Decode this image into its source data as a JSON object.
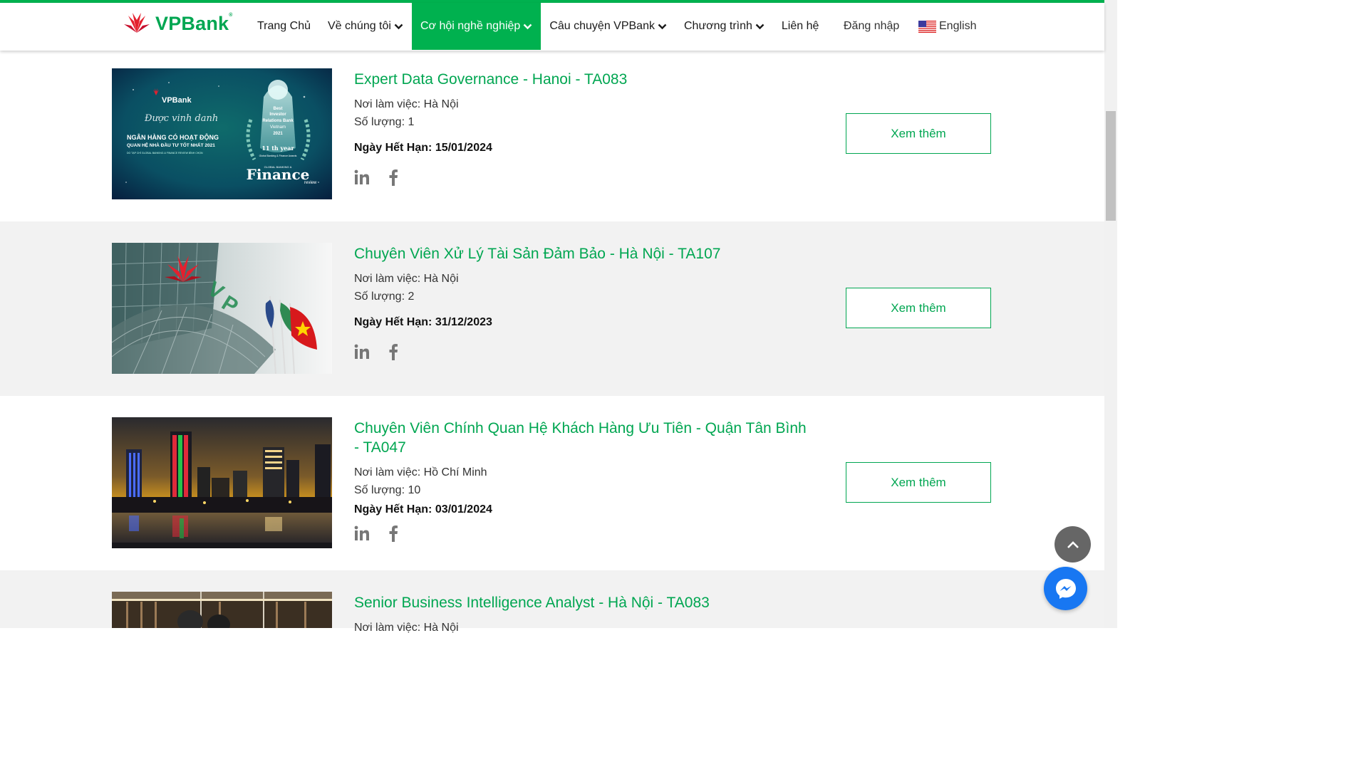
{
  "brand": {
    "name": "VPBank",
    "mark": "®",
    "color": "#00a651",
    "accent": "#00b14f",
    "red": "#e4202e"
  },
  "nav": {
    "items": [
      {
        "label": "Trang Chủ",
        "dropdown": false,
        "active": false
      },
      {
        "label": "Về chúng tôi",
        "dropdown": true,
        "active": false
      },
      {
        "label": "Cơ hội nghề nghiệp",
        "dropdown": true,
        "active": true
      },
      {
        "label": "Câu chuyện VPBank",
        "dropdown": true,
        "active": false
      },
      {
        "label": "Chương trình",
        "dropdown": true,
        "active": false
      },
      {
        "label": "Liên hệ",
        "dropdown": false,
        "active": false
      }
    ],
    "login": "Đăng nhập",
    "language": "English",
    "language_icon": "us-flag-icon"
  },
  "jobs": [
    {
      "title": "Expert Data Governance - Hanoi - TA083",
      "location_label": "Nơi làm việc:",
      "location": "Hà Nội",
      "quantity_label": "Số lượng:",
      "quantity": "1",
      "deadline_label": "Ngày Hết Hạn:",
      "deadline": "15/01/2024",
      "button": "Xem thêm",
      "image": {
        "brand": "VPBank",
        "script": "Được vinh danh",
        "headline1": "NGÂN HÀNG CÓ HOẠT ĐỘNG",
        "headline2": "QUAN HỆ NHÀ ĐẦU TƯ TỐT NHẤT 2021",
        "fine": "DO TẠP CHÍ GLOBAL BANKING & FINANCE REVIEW BÌNH CHỌN",
        "award_line1": "Best",
        "award_line2": "Investor",
        "award_line3": "Relations Bank",
        "award_line4": "Vietnam",
        "award_line5": "2021",
        "award_year": "11 th year",
        "award_org": "Global Banking & Finance Awards",
        "finance": "Finance",
        "finance_sub": "GLOBAL BANKING &",
        "review": "review"
      }
    },
    {
      "title": "Chuyên Viên Xử Lý Tài Sản Đảm Bảo - Hà Nội - TA107",
      "location_label": "Nơi làm việc:",
      "location": "Hà Nội",
      "quantity_label": "Số lượng:",
      "quantity": "2",
      "deadline_label": "Ngày Hết Hạn:",
      "deadline": "31/12/2023",
      "button": "Xem thêm"
    },
    {
      "title": "Chuyên Viên Chính Quan Hệ Khách Hàng Ưu Tiên - Quận Tân Bình - TA047",
      "location_label": "Nơi làm việc:",
      "location": "Hồ Chí Minh",
      "quantity_label": "Số lượng:",
      "quantity": "10",
      "deadline_label": "Ngày Hết Hạn:",
      "deadline": "03/01/2024",
      "button": "Xem thêm"
    },
    {
      "title": "Senior Business Intelligence Analyst - Hà Nội - TA083",
      "location_label": "Nơi làm việc:",
      "location": "Hà Nội"
    }
  ],
  "social_icons": [
    "linkedin-icon",
    "facebook-icon"
  ],
  "floating": {
    "scroll_top_icon": "chevron-up-icon",
    "chat_icon": "messenger-icon"
  }
}
